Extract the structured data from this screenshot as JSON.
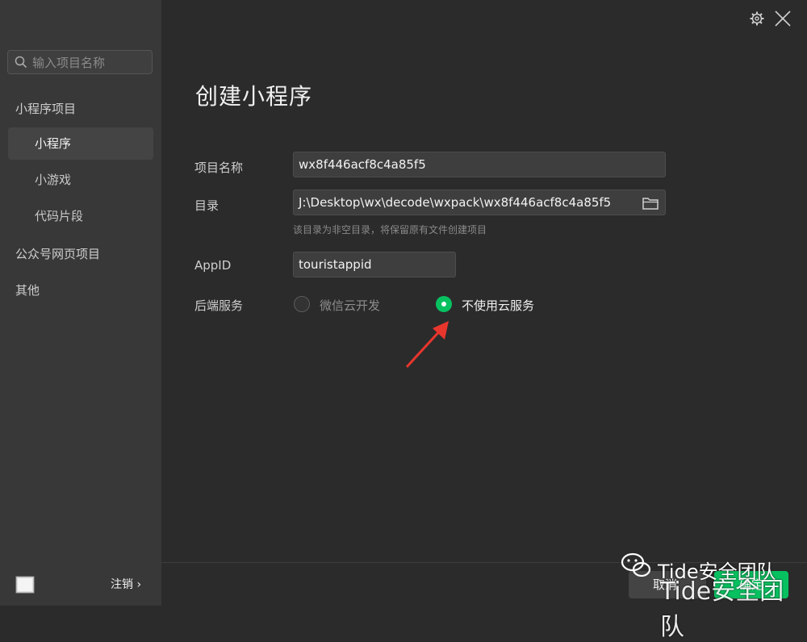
{
  "sidebar": {
    "search_placeholder": "输入项目名称",
    "group_miniprogram": "小程序项目",
    "items": [
      {
        "label": "小程序"
      },
      {
        "label": "小游戏"
      },
      {
        "label": "代码片段"
      }
    ],
    "group_official": "公众号网页项目",
    "group_other": "其他",
    "logout_label": "注销 ›"
  },
  "main": {
    "title": "创建小程序",
    "project_name_label": "项目名称",
    "project_name_value": "wx8f446acf8c4a85f5",
    "directory_label": "目录",
    "directory_value": "J:\\Desktop\\wx\\decode\\wxpack\\wx8f446acf8c4a85f5",
    "directory_hint": "该目录为非空目录，将保留原有文件创建项目",
    "appid_label": "AppID",
    "appid_value": "touristappid",
    "backend_label": "后端服务",
    "backend_options": [
      {
        "label": "微信云开发",
        "selected": false
      },
      {
        "label": "不使用云服务",
        "selected": true
      }
    ]
  },
  "footer": {
    "cancel_label": "取消",
    "ok_label": "确定"
  },
  "watermark": {
    "text": "Tide安全团队"
  },
  "colors": {
    "accent": "#07c160",
    "annotation_arrow": "#e8362d"
  }
}
